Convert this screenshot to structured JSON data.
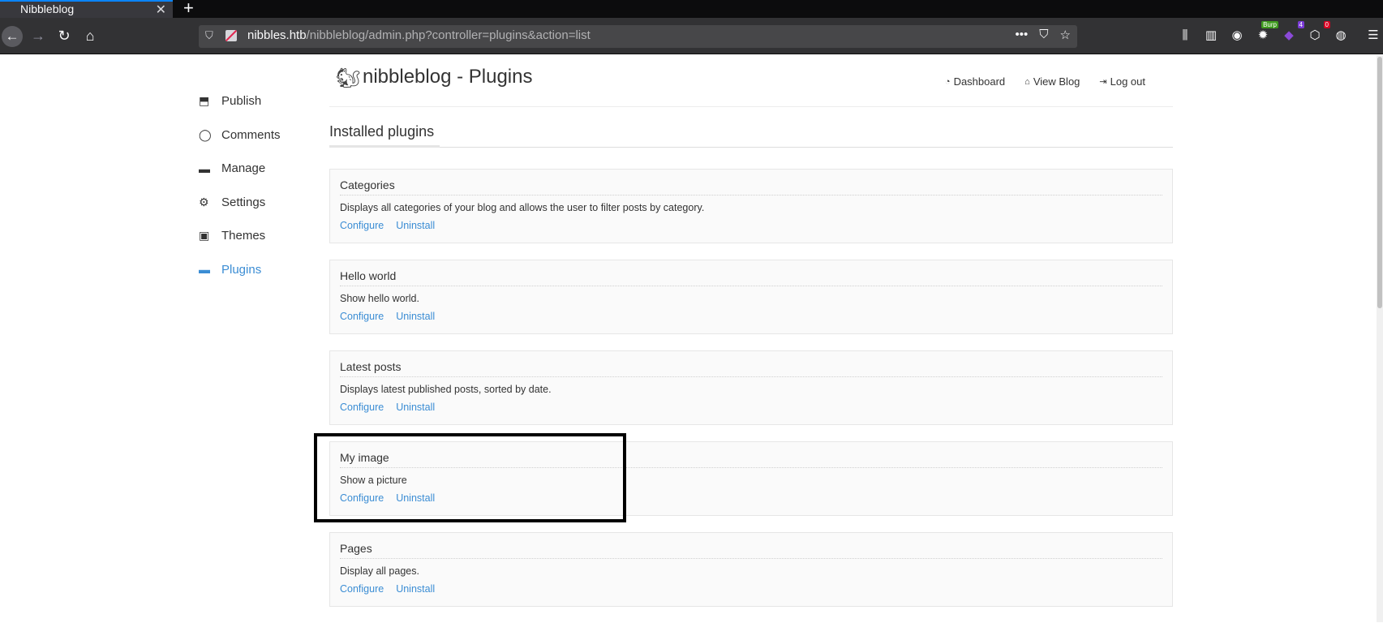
{
  "browser": {
    "tab_title": "Nibbleblog",
    "tab_close": "✕",
    "new_tab": "+",
    "url_host": "nibbles.htb",
    "url_path": "/nibbleblog/admin.php?controller=plugins&action=list",
    "url_actions": [
      "•••",
      "⛉",
      "☆"
    ],
    "toolbar_icons": [
      {
        "name": "library-icon",
        "glyph": "⫼",
        "badge": ""
      },
      {
        "name": "sidebar-icon",
        "glyph": "▥",
        "badge": ""
      },
      {
        "name": "account-icon",
        "glyph": "◉",
        "badge": ""
      },
      {
        "name": "burp-extension-icon",
        "glyph": "✹",
        "badge": "Burp"
      },
      {
        "name": "wappalyzer-extension-icon",
        "glyph": "◆",
        "badge": "4"
      },
      {
        "name": "extension-icon",
        "glyph": "⬡",
        "badge": "0"
      },
      {
        "name": "cookie-icon",
        "glyph": "◍",
        "badge": ""
      }
    ],
    "menu": "☰"
  },
  "sidebar": {
    "items": [
      {
        "label": "Publish",
        "icon": "publish-icon",
        "glyph": "⬒",
        "active": false
      },
      {
        "label": "Comments",
        "icon": "comments-icon",
        "glyph": "◯",
        "active": false
      },
      {
        "label": "Manage",
        "icon": "folder-icon",
        "glyph": "▬",
        "active": false
      },
      {
        "label": "Settings",
        "icon": "gear-icon",
        "glyph": "⚙",
        "active": false
      },
      {
        "label": "Themes",
        "icon": "image-icon",
        "glyph": "▣",
        "active": false
      },
      {
        "label": "Plugins",
        "icon": "folder-icon",
        "glyph": "▬",
        "active": true
      }
    ],
    "active_color": "#3b8dd4"
  },
  "header": {
    "logo_glyph": "🐿",
    "title": "nibbleblog - Plugins",
    "links": [
      {
        "label": "Dashboard",
        "icon": "dashboard-icon",
        "glyph": "◔"
      },
      {
        "label": "View Blog",
        "icon": "home-icon",
        "glyph": "⌂"
      },
      {
        "label": "Log out",
        "icon": "logout-icon",
        "glyph": "⇥"
      }
    ]
  },
  "section": {
    "title": "Installed plugins"
  },
  "plugins": [
    {
      "name": "Categories",
      "description": "Displays all categories of your blog and allows the user to filter posts by category.",
      "configure": "Configure",
      "uninstall": "Uninstall"
    },
    {
      "name": "Hello world",
      "description": "Show hello world.",
      "configure": "Configure",
      "uninstall": "Uninstall"
    },
    {
      "name": "Latest posts",
      "description": "Displays latest published posts, sorted by date.",
      "configure": "Configure",
      "uninstall": "Uninstall"
    },
    {
      "name": "My image",
      "description": "Show a picture",
      "configure": "Configure",
      "uninstall": "Uninstall"
    },
    {
      "name": "Pages",
      "description": "Display all pages.",
      "configure": "Configure",
      "uninstall": "Uninstall"
    }
  ],
  "colors": {
    "link": "#3b8dd4",
    "highlight_border": "#000000"
  }
}
